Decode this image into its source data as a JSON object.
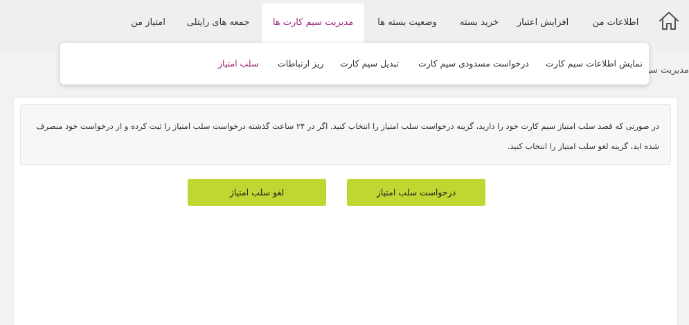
{
  "nav": {
    "home_icon": "home-icon",
    "items": [
      {
        "label": "اطلاعات من"
      },
      {
        "label": "افزایش اعتبار"
      },
      {
        "label": "خرید بسته"
      },
      {
        "label": "وضعیت بسته ها"
      },
      {
        "label": "مدیریت سیم کارت ها"
      },
      {
        "label": "جمعه های رایتلی"
      },
      {
        "label": "امتیاز من"
      }
    ],
    "active_index": 4
  },
  "page": {
    "heading": "مدیریت سیم کارت ها"
  },
  "submenu": {
    "items": [
      {
        "label": "نمایش اطلاعات سیم کارت"
      },
      {
        "label": "درخواست مسدودی سیم کارت"
      },
      {
        "label": "تبدیل سیم کارت"
      },
      {
        "label": "ریز ارتباطات"
      },
      {
        "label": "سلب امتیاز"
      }
    ],
    "active_index": 4
  },
  "notice": {
    "text": "در صورتی که قصد سلب امتیاز سیم کارت خود را دارید، گزینه درخواست سلب امتیاز را انتخاب کنید. اگر در ۲۴ ساعت گذشته درخواست سلب امتیاز را ثبت کرده و از درخواست خود منصرف شده اید، گزینه لغو سلب امتیاز را انتخاب کنید."
  },
  "actions": {
    "request_label": "درخواست سلب امتیاز",
    "cancel_label": "لغو سلب امتیاز"
  },
  "colors": {
    "accent": "#9c2477",
    "button": "#bfd730",
    "nav_bg": "#efefef",
    "page_bg": "#f2f2f2"
  }
}
